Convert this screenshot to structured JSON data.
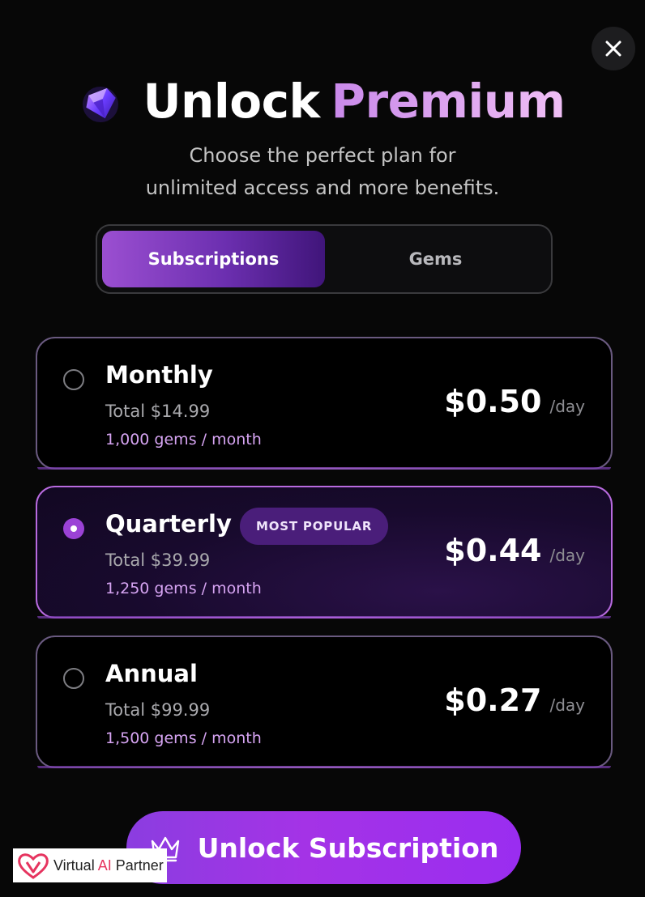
{
  "title": {
    "word1": "Unlock",
    "word2": "Premium"
  },
  "subtitle": {
    "line1": "Choose the perfect plan for",
    "line2": "unlimited access and more benefits."
  },
  "tabs": [
    {
      "label": "Subscriptions",
      "active": true
    },
    {
      "label": "Gems",
      "active": false
    }
  ],
  "plans": [
    {
      "name": "Monthly",
      "total": "Total $14.99",
      "gems": "1,000 gems / month",
      "price": "$0.50",
      "per": "/day",
      "selected": false,
      "badge": ""
    },
    {
      "name": "Quarterly",
      "total": "Total $39.99",
      "gems": "1,250 gems / month",
      "price": "$0.44",
      "per": "/day",
      "selected": true,
      "badge": "MOST POPULAR"
    },
    {
      "name": "Annual",
      "total": "Total $99.99",
      "gems": "1,500 gems / month",
      "price": "$0.27",
      "per": "/day",
      "selected": false,
      "badge": ""
    }
  ],
  "cta": {
    "label": "Unlock Subscription",
    "icon": "crown-icon"
  },
  "watermark": {
    "part1": "Virtual ",
    "part2": "AI",
    "part3": " Partner"
  },
  "icons": {
    "close": "close-icon",
    "gem": "gem-icon"
  },
  "colors": {
    "accent": "#9b42d6",
    "accent_light": "#d6a4f2",
    "background": "#070707"
  }
}
